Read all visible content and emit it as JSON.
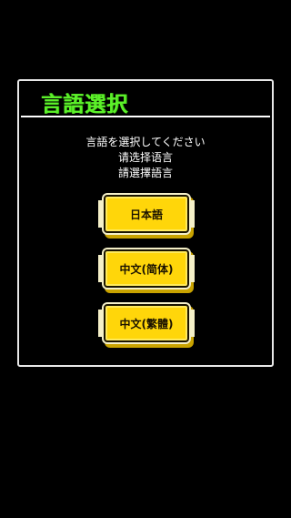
{
  "dialog": {
    "title": "言語選択",
    "prompt_ja": "言語を選択してください",
    "prompt_zh_hans": "请选择语言",
    "prompt_zh_hant": "請選擇語言"
  },
  "buttons": {
    "japanese": "日本語",
    "chinese_simplified": "中文(简体)",
    "chinese_traditional": "中文(繁體)"
  },
  "colors": {
    "background": "#000000",
    "title": "#5cf02a",
    "button": "#ffd60a",
    "border": "#e8e8e8"
  }
}
